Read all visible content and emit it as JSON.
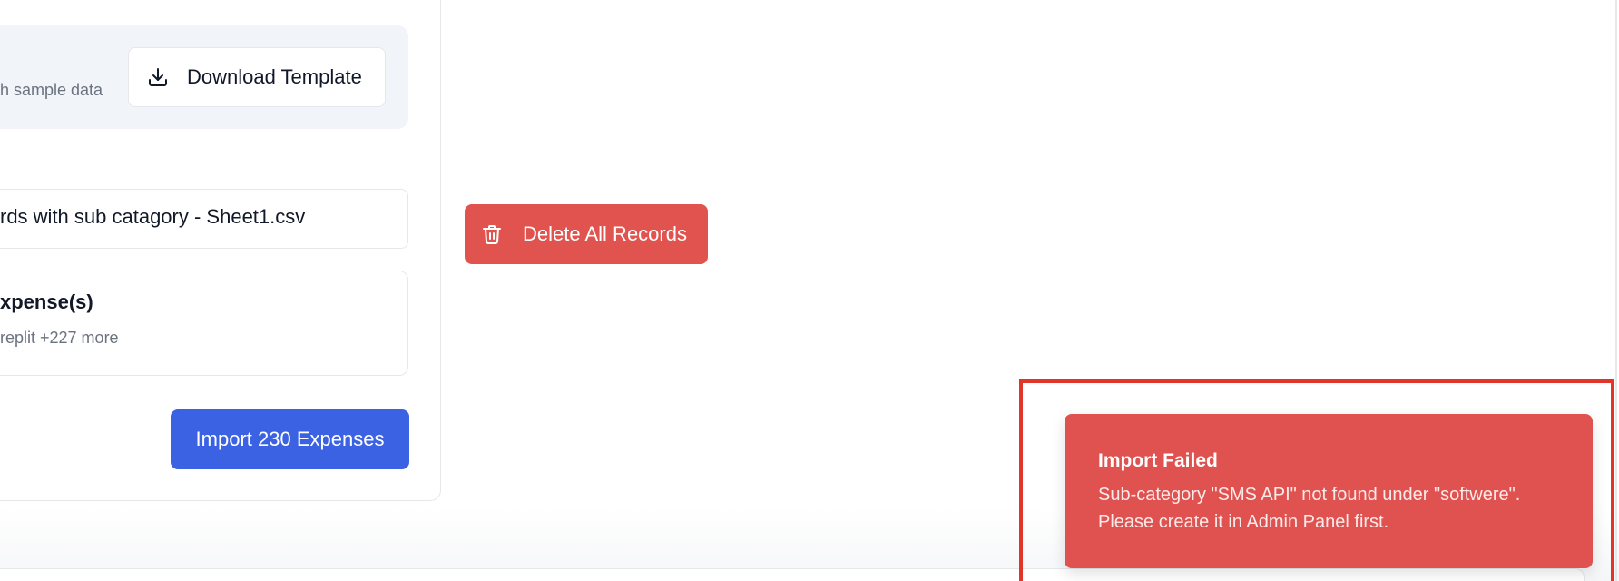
{
  "template": {
    "hint_text": "h sample data",
    "download_label": "Download Template",
    "download_icon": "download-icon"
  },
  "upload": {
    "file_name": "rds with sub catagory - Sheet1.csv"
  },
  "summary": {
    "title": "xpense(s)",
    "subtitle": "replit +227 more"
  },
  "actions": {
    "import_label": "Import 230 Expenses",
    "delete_label": "Delete All Records",
    "delete_icon": "trash-icon"
  },
  "toast": {
    "title": "Import Failed",
    "message": "Sub-category \"SMS API\" not found under \"softwere\". Please create it in Admin Panel first."
  },
  "colors": {
    "primary": "#3b62e3",
    "danger": "#e1534f",
    "toast_bg": "#df524f",
    "highlight": "#e2352a"
  }
}
